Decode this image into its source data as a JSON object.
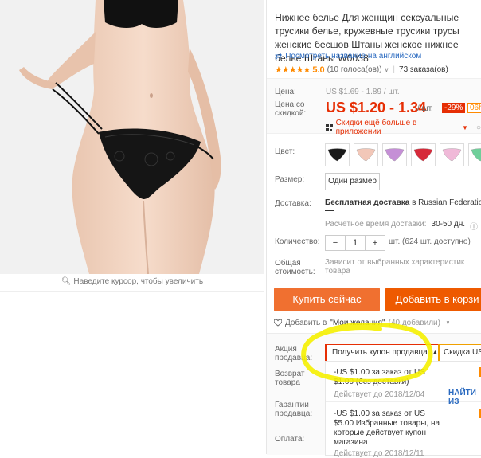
{
  "product": {
    "title": "Нижнее белье Для женщин сексуальные трусики белье, кружевные трусики трусы женские бесшов Штаны женское нижнее белье Штаны W0038",
    "zoom_hint": "Наведите курсор, чтобы увеличить",
    "translate_link": "Посмотреть название на английском",
    "rating_value": "5.0",
    "stars": "★★★★★",
    "reviews": "(10 голоса(ов))",
    "reviews_dropdown": "∨",
    "orders": "73 заказа(ов)"
  },
  "price": {
    "label": "Цена:",
    "old": "US $1.69 - 1.89 / шт.",
    "discount_label": "Цена со скидкой:",
    "current": "US $1.20 - 1.34",
    "unit": "/ шт.",
    "discount_badge": "-29%",
    "timer": "06h",
    "app_discount": "Скидки ещё больше в приложении",
    "app_caret": "▼"
  },
  "options": {
    "color_label": "Цвет:",
    "swatch_colors": [
      "#1a1a1a",
      "#f2c7b8",
      "#c58fd6",
      "#d62a3a",
      "#f0b9d8",
      "#6fcf9a"
    ],
    "size_label": "Размер:",
    "size_value": "Один размер",
    "shipping_label": "Доставка:",
    "shipping_bold": "Бесплатная доставка",
    "shipping_rest": "в Russian Federation c",
    "delivery_time_label": "Расчётное время доставки:",
    "delivery_time_value": "30-50 дн.",
    "quantity_label": "Количество:",
    "quantity_minus": "−",
    "quantity_value": "1",
    "quantity_plus": "+",
    "quantity_available": "шт. (624 шт. доступно)",
    "total_label": "Общая стоимость:",
    "total_note": "Зависит от выбранных характеристик товара"
  },
  "actions": {
    "buy_now": "Купить сейчас",
    "add_to_cart": "Добавить в корзи",
    "wishlist_prefix": "Добавить в",
    "wishlist_name": "\"Мои желания\"",
    "wishlist_count": "(40 добавили)",
    "wishlist_dropdown": "∨"
  },
  "promotions": {
    "store_promo_label": "Акция продавца:",
    "get_coupon": "Получить купон продавца",
    "get_coupon_caret": "▲",
    "store_discount": "Скидка US",
    "returns_label": "Возврат товара",
    "guarantee_label": "Гарантии продавца:",
    "payment_label": "Оплата:",
    "coupons": [
      {
        "text": "-US $1.00 за заказ от US $1.00 (без доставки)",
        "valid": "Действует до 2018/12/04"
      },
      {
        "text": "-US $1.00 за заказ от US $5.00 Избранные товары, на которые действует купон магазина",
        "valid": "Действует до 2018/12/11"
      }
    ],
    "get_now": "НАЙТИ ИЗ"
  },
  "colors": {
    "accent": "#e62e04",
    "buy_button": "#f07030",
    "cart_button": "#ee5a00",
    "link": "#2a6ac0",
    "highlight": "#f5f000"
  }
}
